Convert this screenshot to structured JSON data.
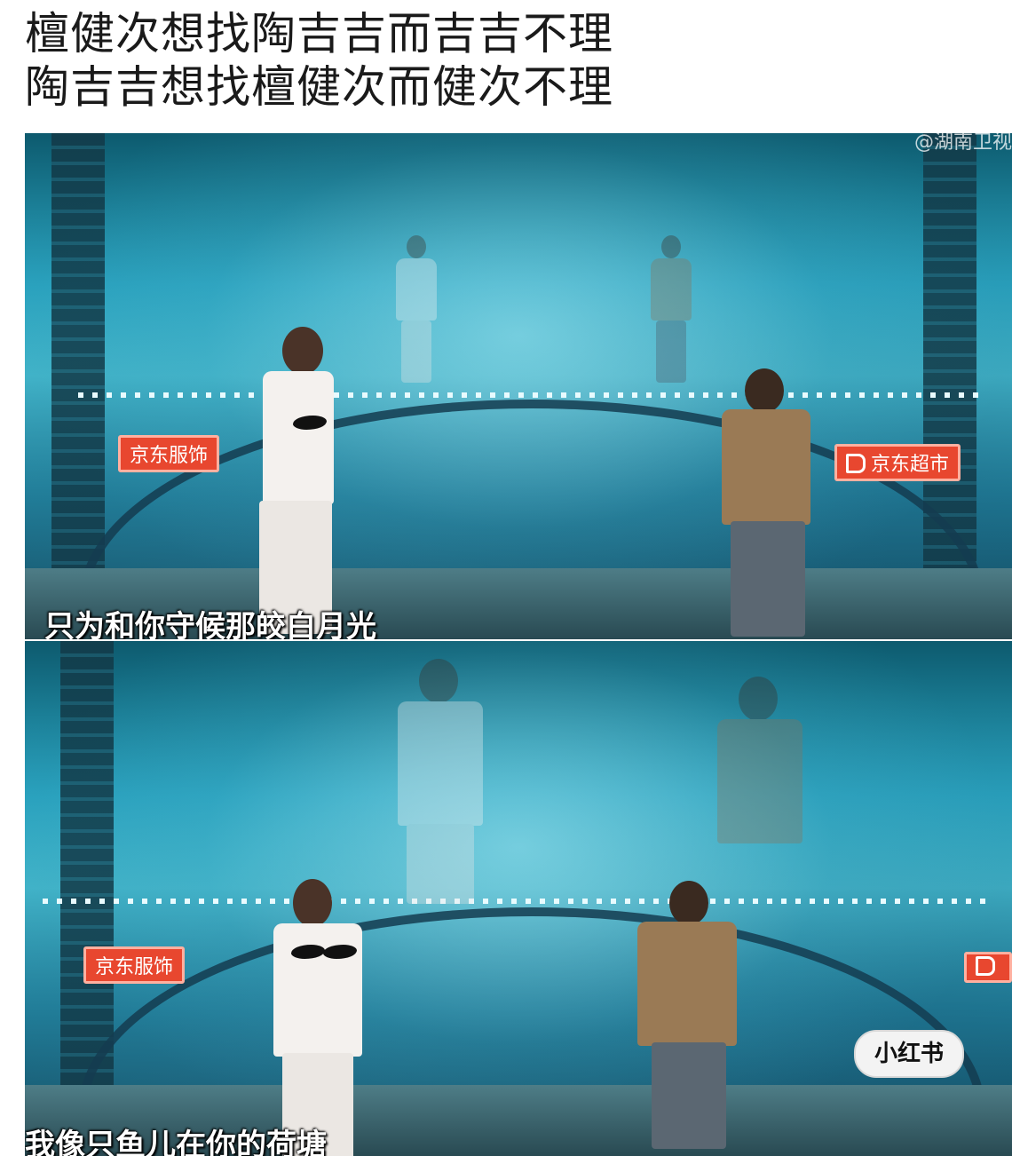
{
  "caption": {
    "line1": "檀健次想找陶吉吉而吉吉不理",
    "line2": "陶吉吉想找檀健次而健次不理"
  },
  "frames": [
    {
      "watermark": "@湖南卫视",
      "subtitle": "只为和你守候那皎白月光",
      "signs": [
        "京东服饰",
        "京东超市"
      ]
    },
    {
      "subtitle": "我像只鱼儿在你的荷塘",
      "signs": [
        "京东服饰"
      ]
    }
  ],
  "badge": {
    "label": "小红书"
  },
  "colors": {
    "brand_red": "#e8472f",
    "stage_cyan": "#48c3d6"
  }
}
